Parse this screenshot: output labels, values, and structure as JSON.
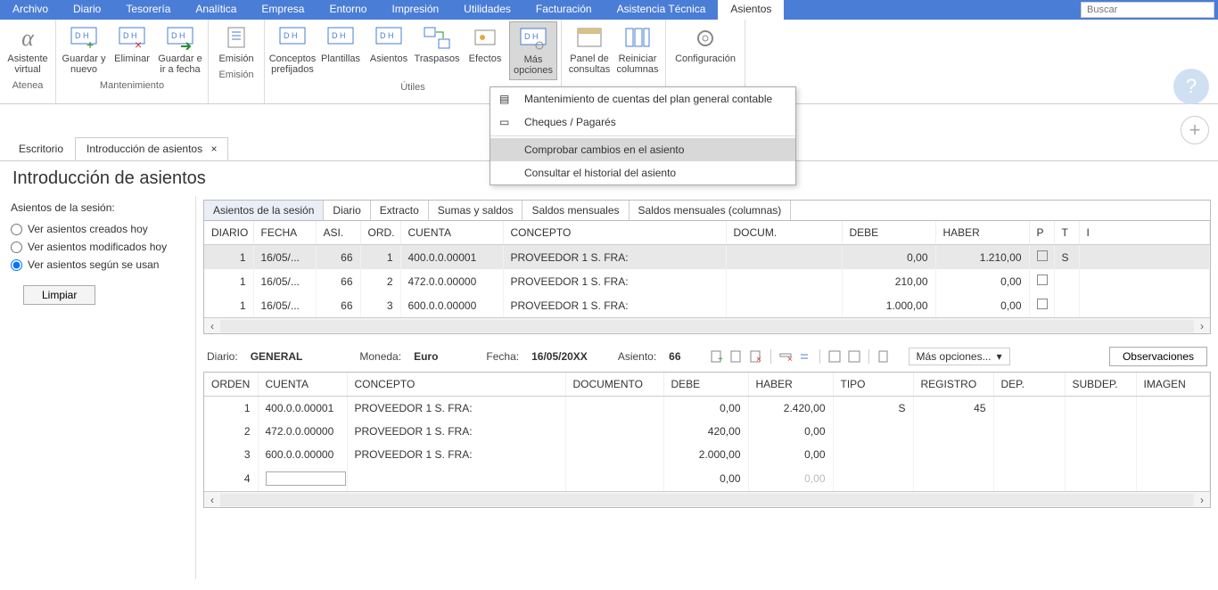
{
  "menubar": {
    "items": [
      "Archivo",
      "Diario",
      "Tesorería",
      "Analítica",
      "Empresa",
      "Entorno",
      "Impresión",
      "Utilidades",
      "Facturación",
      "Asistencia Técnica",
      "Asientos"
    ],
    "active_index": 10,
    "search_placeholder": "Buscar"
  },
  "ribbon": {
    "groups": [
      {
        "label": "Atenea",
        "buttons": [
          {
            "name": "asistente-virtual",
            "label": "Asistente virtual"
          }
        ]
      },
      {
        "label": "Mantenimiento",
        "buttons": [
          {
            "name": "guardar-nuevo",
            "label": "Guardar y nuevo"
          },
          {
            "name": "eliminar",
            "label": "Eliminar"
          },
          {
            "name": "guardar-ir-fecha",
            "label": "Guardar e ir a fecha",
            "dropdown": true
          }
        ]
      },
      {
        "label": "Emisión",
        "buttons": [
          {
            "name": "emision",
            "label": "Emisión",
            "dropdown": true
          }
        ]
      },
      {
        "label": "Útiles",
        "buttons": [
          {
            "name": "conceptos-prefijados",
            "label": "Conceptos prefijados"
          },
          {
            "name": "plantillas",
            "label": "Plantillas",
            "dropdown": true
          },
          {
            "name": "asientos",
            "label": "Asientos",
            "dropdown": true
          },
          {
            "name": "traspasos",
            "label": "Traspasos",
            "dropdown": true
          },
          {
            "name": "efectos",
            "label": "Efectos",
            "dropdown": true
          },
          {
            "name": "mas-opciones",
            "label": "Más opciones",
            "dropdown": true,
            "active": true
          }
        ]
      },
      {
        "label": "",
        "buttons": [
          {
            "name": "panel-consultas",
            "label": "Panel de consultas"
          },
          {
            "name": "reiniciar-columnas",
            "label": "Reiniciar columnas"
          }
        ]
      },
      {
        "label": "",
        "buttons": [
          {
            "name": "configuracion",
            "label": "Configuración"
          }
        ]
      }
    ]
  },
  "dropdown": {
    "items": [
      {
        "label": "Mantenimiento de cuentas del plan general contable",
        "icon": "tree-icon"
      },
      {
        "label": "Cheques / Pagarés",
        "icon": "cheque-icon"
      },
      {
        "label": "Comprobar cambios en el asiento",
        "highlighted": true
      },
      {
        "label": "Consultar el historial del asiento"
      }
    ]
  },
  "tabs": {
    "items": [
      {
        "label": "Escritorio"
      },
      {
        "label": "Introducción de asientos",
        "active": true,
        "closable": true
      }
    ]
  },
  "page_title": "Introducción de asientos",
  "sidebar": {
    "title": "Asientos de la sesión:",
    "radio_options": [
      "Ver asientos creados hoy",
      "Ver asientos modificados hoy",
      "Ver asientos según se usan"
    ],
    "selected_index": 2,
    "limpiar_label": "Limpiar"
  },
  "grid_tabs": [
    "Asientos de la sesión",
    "Diario",
    "Extracto",
    "Sumas y saldos",
    "Saldos mensuales",
    "Saldos mensuales (columnas)"
  ],
  "grid_active_tab": 0,
  "top_grid": {
    "headers": [
      "DIARIO",
      "FECHA",
      "ASI.",
      "ORD.",
      "CUENTA",
      "CONCEPTO",
      "DOCUM.",
      "DEBE",
      "HABER",
      "P",
      "T",
      "I"
    ],
    "rows": [
      {
        "diario": "1",
        "fecha": "16/05/...",
        "asi": "66",
        "ord": "1",
        "cuenta": "400.0.0.00001",
        "concepto": "PROVEEDOR 1 S. FRA:",
        "docum": "",
        "debe": "0,00",
        "haber": "1.210,00",
        "p": false,
        "t": "S",
        "highlight": true
      },
      {
        "diario": "1",
        "fecha": "16/05/...",
        "asi": "66",
        "ord": "2",
        "cuenta": "472.0.0.00000",
        "concepto": "PROVEEDOR 1 S. FRA:",
        "docum": "",
        "debe": "210,00",
        "haber": "0,00",
        "p": false,
        "t": ""
      },
      {
        "diario": "1",
        "fecha": "16/05/...",
        "asi": "66",
        "ord": "3",
        "cuenta": "600.0.0.00000",
        "concepto": "PROVEEDOR 1 S. FRA:",
        "docum": "",
        "debe": "1.000,00",
        "haber": "0,00",
        "p": false,
        "t": ""
      }
    ]
  },
  "info_bar": {
    "diario_label": "Diario:",
    "diario_value": "GENERAL",
    "moneda_label": "Moneda:",
    "moneda_value": "Euro",
    "fecha_label": "Fecha:",
    "fecha_value": "16/05/20XX",
    "asiento_label": "Asiento:",
    "asiento_value": "66",
    "mas_opciones_label": "Más opciones...",
    "observaciones_label": "Observaciones"
  },
  "detail_grid": {
    "headers": [
      "ORDEN",
      "CUENTA",
      "CONCEPTO",
      "DOCUMENTO",
      "DEBE",
      "HABER",
      "TIPO",
      "REGISTRO",
      "DEP.",
      "SUBDEP.",
      "IMAGEN"
    ],
    "rows": [
      {
        "orden": "1",
        "cuenta": "400.0.0.00001",
        "concepto": "PROVEEDOR 1 S. FRA:",
        "documento": "",
        "debe": "0,00",
        "haber": "2.420,00",
        "tipo": "S",
        "registro": "45",
        "dep": "",
        "subdep": "",
        "imagen": ""
      },
      {
        "orden": "2",
        "cuenta": "472.0.0.00000",
        "concepto": "PROVEEDOR 1 S. FRA:",
        "documento": "",
        "debe": "420,00",
        "haber": "0,00",
        "tipo": "",
        "registro": "",
        "dep": "",
        "subdep": "",
        "imagen": ""
      },
      {
        "orden": "3",
        "cuenta": "600.0.0.00000",
        "concepto": "PROVEEDOR 1 S. FRA:",
        "documento": "",
        "debe": "2.000,00",
        "haber": "0,00",
        "tipo": "",
        "registro": "",
        "dep": "",
        "subdep": "",
        "imagen": ""
      },
      {
        "orden": "4",
        "cuenta": "",
        "concepto": "",
        "documento": "",
        "debe": "0,00",
        "haber": "0,00",
        "tipo": "",
        "registro": "",
        "dep": "",
        "subdep": "",
        "imagen": "",
        "editing": true
      }
    ]
  }
}
